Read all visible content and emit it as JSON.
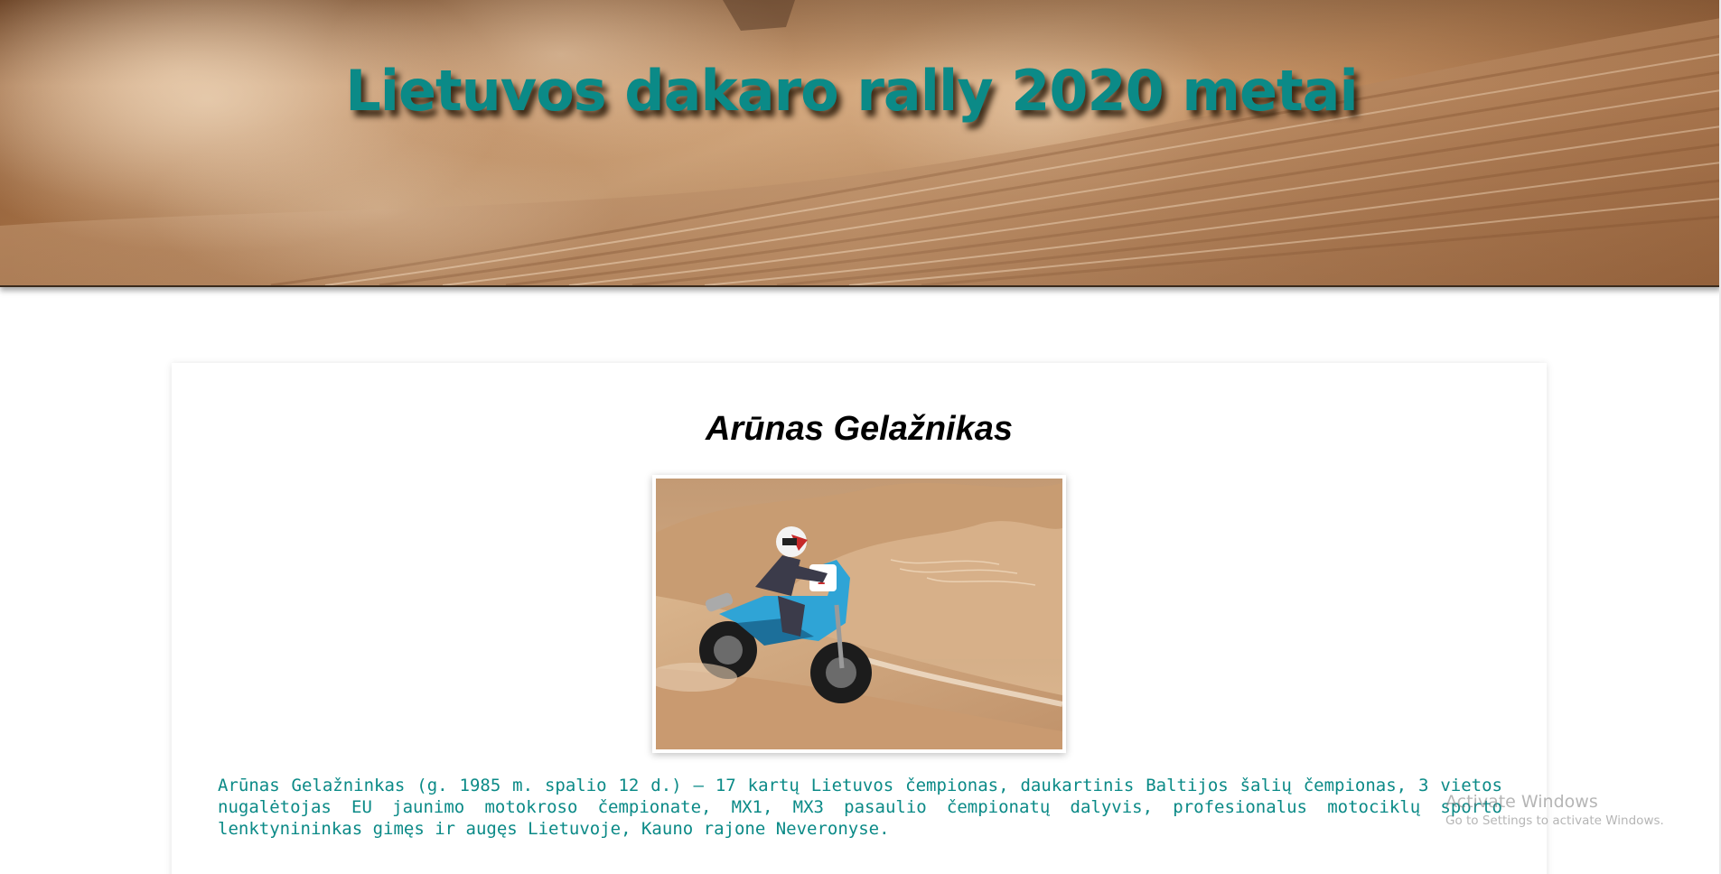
{
  "header": {
    "title": "Lietuvos dakaro rally 2020 metai",
    "title_color": "#0b8a87"
  },
  "racer": {
    "name": "Arūnas Gelažnikas",
    "bio": "Arūnas Gelažninkas (g. 1985 m. spalio 12 d.) – 17 kartų Lietuvos čempionas, daukartinis Baltijos šalių čempionas, 3 vietos nugalėtojas EU jaunimo motokroso čempionate, MX1, MX3 pasaulio čempionatų dalyvis, profesionalus motociklų sporto lenktynininkas gimęs ir augęs Lietuvoje, Kauno rajone Neveronyse.",
    "bio_color": "#0b8a87",
    "photo": {
      "icon": "motorcycle-rider-in-desert-photo",
      "bike_color": "#2fa4d6"
    }
  },
  "windows_watermark": {
    "title": "Activate Windows",
    "subtitle": "Go to Settings to activate Windows."
  }
}
